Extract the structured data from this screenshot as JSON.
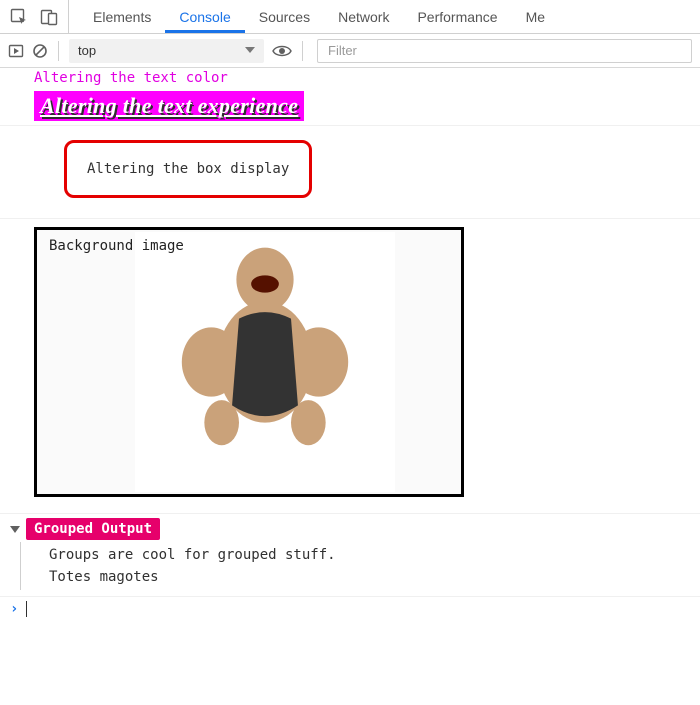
{
  "tabs": {
    "items": [
      "Elements",
      "Console",
      "Sources",
      "Network",
      "Performance",
      "Me"
    ],
    "active_index": 1
  },
  "toolbar": {
    "context": "top",
    "filter_placeholder": "Filter"
  },
  "logs": {
    "line1_text": "Altering the text color",
    "line2_text": "Altering the text experience",
    "box_text": "Altering the box display",
    "img_label": "Background image",
    "group": {
      "title": "Grouped Output",
      "children": [
        "Groups are cool for grouped stuff.",
        "Totes magotes"
      ]
    }
  }
}
